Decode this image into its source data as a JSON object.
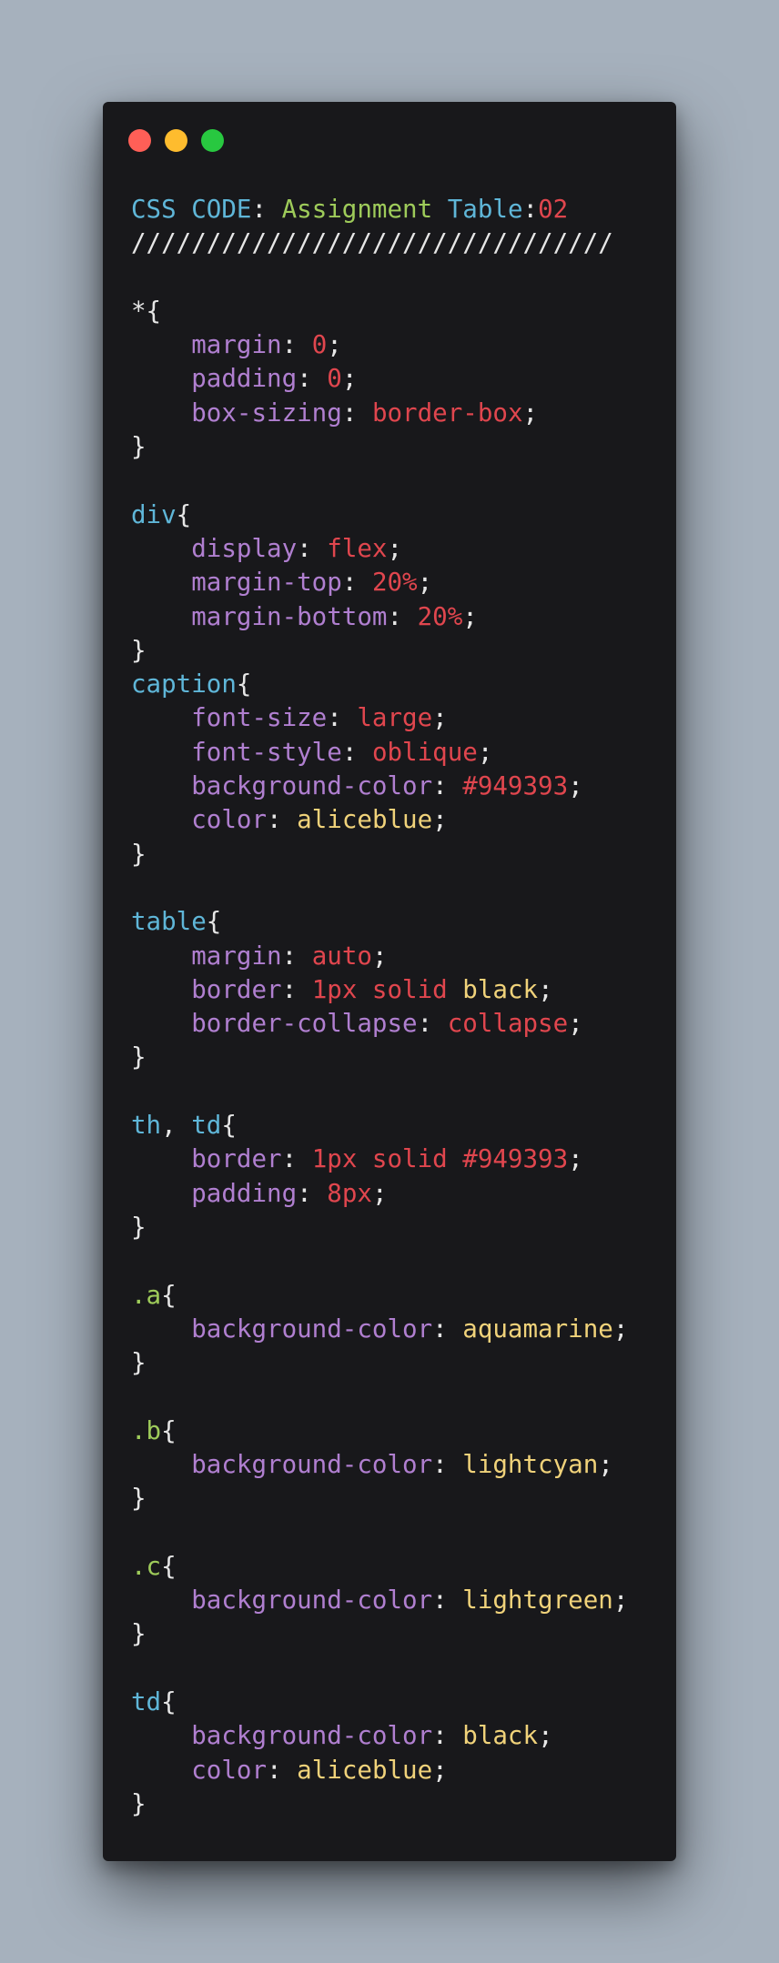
{
  "window": {
    "controls": [
      "close",
      "minimize",
      "maximize"
    ]
  },
  "colors": {
    "background": "#a6b1bd",
    "editor": "#18181b",
    "selector": "#5fb6d8",
    "class_selector": "#9ecb5a",
    "property": "#b07fd0",
    "value": "#e0464e",
    "keyword": "#f0d27a",
    "punctuation": "#e6e6e6"
  },
  "code_lines": [
    [
      {
        "t": "CSS CODE",
        "k": "sel"
      },
      {
        "t": ": ",
        "k": "punc"
      },
      {
        "t": "Assignment",
        "k": "str"
      },
      {
        "t": " ",
        "k": "punc"
      },
      {
        "t": "Table",
        "k": "sel"
      },
      {
        "t": ":",
        "k": "punc"
      },
      {
        "t": "02",
        "k": "val"
      }
    ],
    [
      {
        "t": "////////////////////////////////",
        "k": "punc"
      }
    ],
    [],
    [
      {
        "t": "*{",
        "k": "punc"
      }
    ],
    [
      {
        "t": "    ",
        "k": "punc"
      },
      {
        "t": "margin",
        "k": "prop"
      },
      {
        "t": ": ",
        "k": "punc"
      },
      {
        "t": "0",
        "k": "val"
      },
      {
        "t": ";",
        "k": "punc"
      }
    ],
    [
      {
        "t": "    ",
        "k": "punc"
      },
      {
        "t": "padding",
        "k": "prop"
      },
      {
        "t": ": ",
        "k": "punc"
      },
      {
        "t": "0",
        "k": "val"
      },
      {
        "t": ";",
        "k": "punc"
      }
    ],
    [
      {
        "t": "    ",
        "k": "punc"
      },
      {
        "t": "box-sizing",
        "k": "prop"
      },
      {
        "t": ": ",
        "k": "punc"
      },
      {
        "t": "border-box",
        "k": "val"
      },
      {
        "t": ";",
        "k": "punc"
      }
    ],
    [
      {
        "t": "}",
        "k": "punc"
      }
    ],
    [],
    [
      {
        "t": "div",
        "k": "sel"
      },
      {
        "t": "{",
        "k": "punc"
      }
    ],
    [
      {
        "t": "    ",
        "k": "punc"
      },
      {
        "t": "display",
        "k": "prop"
      },
      {
        "t": ": ",
        "k": "punc"
      },
      {
        "t": "flex",
        "k": "val"
      },
      {
        "t": ";",
        "k": "punc"
      }
    ],
    [
      {
        "t": "    ",
        "k": "punc"
      },
      {
        "t": "margin-top",
        "k": "prop"
      },
      {
        "t": ": ",
        "k": "punc"
      },
      {
        "t": "20%",
        "k": "val"
      },
      {
        "t": ";",
        "k": "punc"
      }
    ],
    [
      {
        "t": "    ",
        "k": "punc"
      },
      {
        "t": "margin-bottom",
        "k": "prop"
      },
      {
        "t": ": ",
        "k": "punc"
      },
      {
        "t": "20%",
        "k": "val"
      },
      {
        "t": ";",
        "k": "punc"
      }
    ],
    [
      {
        "t": "}",
        "k": "punc"
      }
    ],
    [
      {
        "t": "caption",
        "k": "sel"
      },
      {
        "t": "{",
        "k": "punc"
      }
    ],
    [
      {
        "t": "    ",
        "k": "punc"
      },
      {
        "t": "font-size",
        "k": "prop"
      },
      {
        "t": ": ",
        "k": "punc"
      },
      {
        "t": "large",
        "k": "val"
      },
      {
        "t": ";",
        "k": "punc"
      }
    ],
    [
      {
        "t": "    ",
        "k": "punc"
      },
      {
        "t": "font-style",
        "k": "prop"
      },
      {
        "t": ": ",
        "k": "punc"
      },
      {
        "t": "oblique",
        "k": "val"
      },
      {
        "t": ";",
        "k": "punc"
      }
    ],
    [
      {
        "t": "    ",
        "k": "punc"
      },
      {
        "t": "background-color",
        "k": "prop"
      },
      {
        "t": ": ",
        "k": "punc"
      },
      {
        "t": "#949393",
        "k": "val"
      },
      {
        "t": ";",
        "k": "punc"
      }
    ],
    [
      {
        "t": "    ",
        "k": "punc"
      },
      {
        "t": "color",
        "k": "prop"
      },
      {
        "t": ": ",
        "k": "punc"
      },
      {
        "t": "aliceblue",
        "k": "kw"
      },
      {
        "t": ";",
        "k": "punc"
      }
    ],
    [
      {
        "t": "}",
        "k": "punc"
      }
    ],
    [],
    [
      {
        "t": "table",
        "k": "sel"
      },
      {
        "t": "{",
        "k": "punc"
      }
    ],
    [
      {
        "t": "    ",
        "k": "punc"
      },
      {
        "t": "margin",
        "k": "prop"
      },
      {
        "t": ": ",
        "k": "punc"
      },
      {
        "t": "auto",
        "k": "val"
      },
      {
        "t": ";",
        "k": "punc"
      }
    ],
    [
      {
        "t": "    ",
        "k": "punc"
      },
      {
        "t": "border",
        "k": "prop"
      },
      {
        "t": ": ",
        "k": "punc"
      },
      {
        "t": "1px solid",
        "k": "val"
      },
      {
        "t": " ",
        "k": "punc"
      },
      {
        "t": "black",
        "k": "kw"
      },
      {
        "t": ";",
        "k": "punc"
      }
    ],
    [
      {
        "t": "    ",
        "k": "punc"
      },
      {
        "t": "border-collapse",
        "k": "prop"
      },
      {
        "t": ": ",
        "k": "punc"
      },
      {
        "t": "collapse",
        "k": "val"
      },
      {
        "t": ";",
        "k": "punc"
      }
    ],
    [
      {
        "t": "}",
        "k": "punc"
      }
    ],
    [],
    [
      {
        "t": "th",
        "k": "sel"
      },
      {
        "t": ", ",
        "k": "punc"
      },
      {
        "t": "td",
        "k": "sel"
      },
      {
        "t": "{",
        "k": "punc"
      }
    ],
    [
      {
        "t": "    ",
        "k": "punc"
      },
      {
        "t": "border",
        "k": "prop"
      },
      {
        "t": ": ",
        "k": "punc"
      },
      {
        "t": "1px solid #949393",
        "k": "val"
      },
      {
        "t": ";",
        "k": "punc"
      }
    ],
    [
      {
        "t": "    ",
        "k": "punc"
      },
      {
        "t": "padding",
        "k": "prop"
      },
      {
        "t": ": ",
        "k": "punc"
      },
      {
        "t": "8px",
        "k": "val"
      },
      {
        "t": ";",
        "k": "punc"
      }
    ],
    [
      {
        "t": "}",
        "k": "punc"
      }
    ],
    [],
    [
      {
        "t": ".a",
        "k": "cls"
      },
      {
        "t": "{",
        "k": "punc"
      }
    ],
    [
      {
        "t": "    ",
        "k": "punc"
      },
      {
        "t": "background-color",
        "k": "prop"
      },
      {
        "t": ": ",
        "k": "punc"
      },
      {
        "t": "aquamarine",
        "k": "kw"
      },
      {
        "t": ";",
        "k": "punc"
      }
    ],
    [
      {
        "t": "}",
        "k": "punc"
      }
    ],
    [],
    [
      {
        "t": ".b",
        "k": "cls"
      },
      {
        "t": "{",
        "k": "punc"
      }
    ],
    [
      {
        "t": "    ",
        "k": "punc"
      },
      {
        "t": "background-color",
        "k": "prop"
      },
      {
        "t": ": ",
        "k": "punc"
      },
      {
        "t": "lightcyan",
        "k": "kw"
      },
      {
        "t": ";",
        "k": "punc"
      }
    ],
    [
      {
        "t": "}",
        "k": "punc"
      }
    ],
    [],
    [
      {
        "t": ".c",
        "k": "cls"
      },
      {
        "t": "{",
        "k": "punc"
      }
    ],
    [
      {
        "t": "    ",
        "k": "punc"
      },
      {
        "t": "background-color",
        "k": "prop"
      },
      {
        "t": ": ",
        "k": "punc"
      },
      {
        "t": "lightgreen",
        "k": "kw"
      },
      {
        "t": ";",
        "k": "punc"
      }
    ],
    [
      {
        "t": "}",
        "k": "punc"
      }
    ],
    [],
    [
      {
        "t": "td",
        "k": "sel"
      },
      {
        "t": "{",
        "k": "punc"
      }
    ],
    [
      {
        "t": "    ",
        "k": "punc"
      },
      {
        "t": "background-color",
        "k": "prop"
      },
      {
        "t": ": ",
        "k": "punc"
      },
      {
        "t": "black",
        "k": "kw"
      },
      {
        "t": ";",
        "k": "punc"
      }
    ],
    [
      {
        "t": "    ",
        "k": "punc"
      },
      {
        "t": "color",
        "k": "prop"
      },
      {
        "t": ": ",
        "k": "punc"
      },
      {
        "t": "aliceblue",
        "k": "kw"
      },
      {
        "t": ";",
        "k": "punc"
      }
    ],
    [
      {
        "t": "}",
        "k": "punc"
      }
    ]
  ]
}
